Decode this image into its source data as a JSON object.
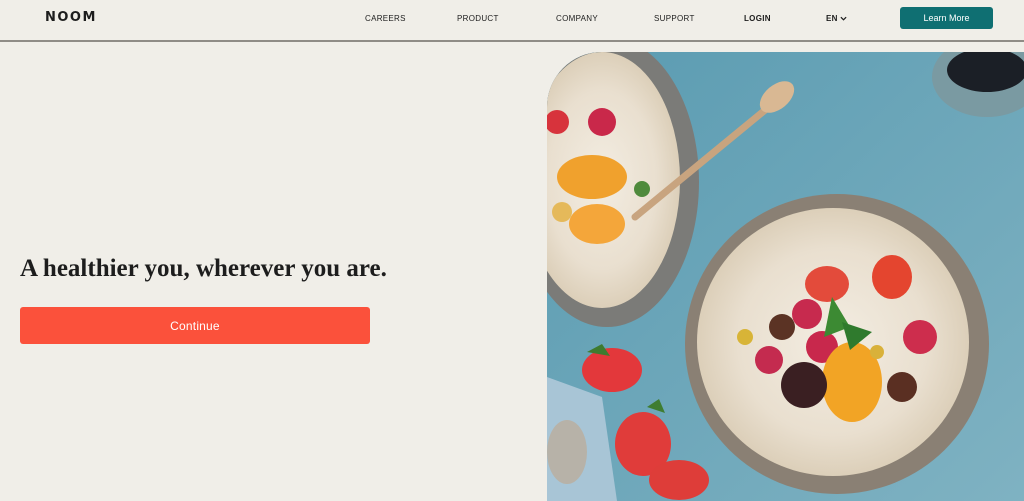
{
  "header": {
    "logo": "NOOM",
    "nav": {
      "careers": "CAREERS",
      "product": "PRODUCT",
      "company": "COMPANY",
      "support": "SUPPORT",
      "login": "LOGIN",
      "language": "EN"
    },
    "cta_label": "Learn More"
  },
  "hero": {
    "headline": "A healthier you, wherever you are.",
    "continue_label": "Continue"
  },
  "colors": {
    "background": "#f0eee8",
    "header_cta": "#0f6f72",
    "continue_button": "#fb513b",
    "text": "#1d1d1d"
  },
  "icons": {
    "language_dropdown": "chevron-down-icon"
  }
}
